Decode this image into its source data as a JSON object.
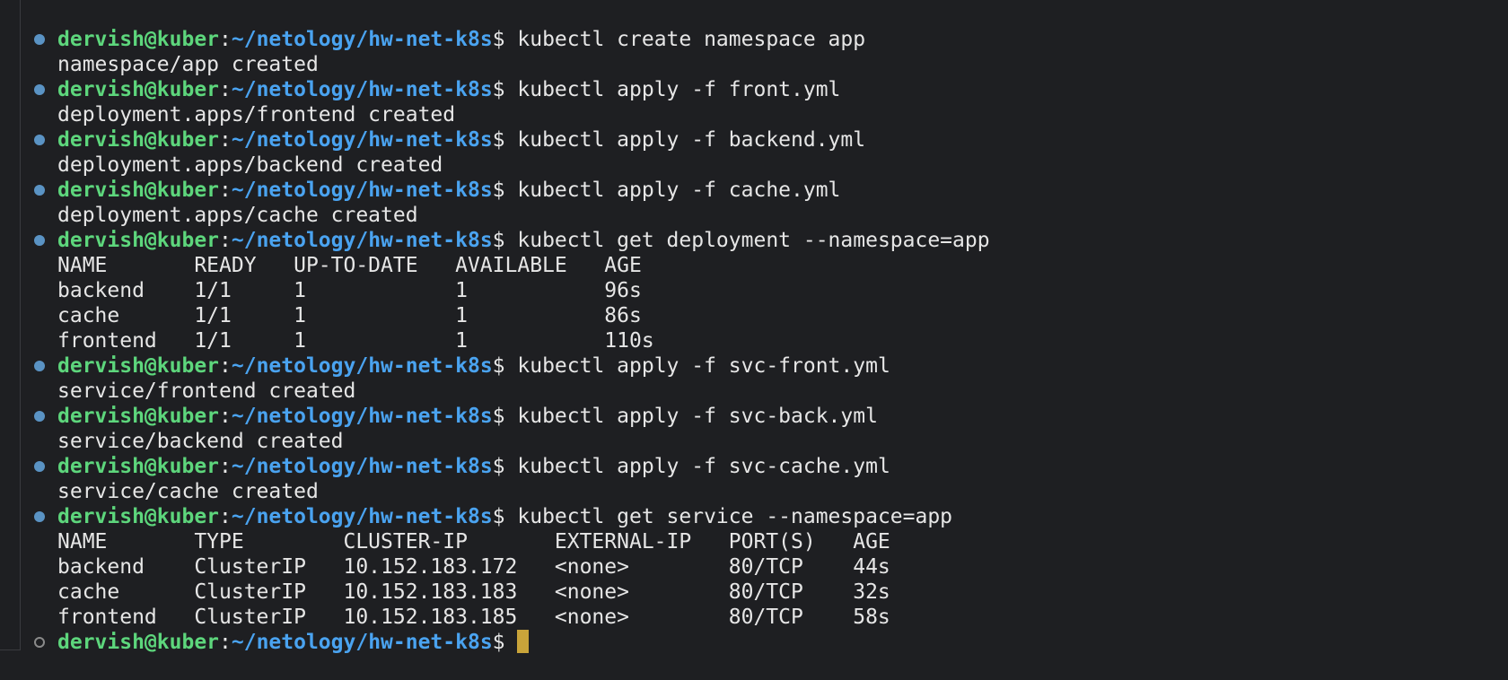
{
  "prompt": {
    "user_host": "dervish@kuber",
    "colon": ":",
    "path": "~/netology/hw-net-k8s",
    "sign": "$ "
  },
  "lines": [
    {
      "kind": "prompt",
      "status": "done",
      "cmd": "kubectl create namespace app"
    },
    {
      "kind": "output",
      "text": "namespace/app created"
    },
    {
      "kind": "prompt",
      "status": "done",
      "cmd": "kubectl apply -f front.yml"
    },
    {
      "kind": "output",
      "text": "deployment.apps/frontend created"
    },
    {
      "kind": "prompt",
      "status": "done",
      "cmd": "kubectl apply -f backend.yml"
    },
    {
      "kind": "output",
      "text": "deployment.apps/backend created"
    },
    {
      "kind": "prompt",
      "status": "done",
      "cmd": "kubectl apply -f cache.yml"
    },
    {
      "kind": "output",
      "text": "deployment.apps/cache created"
    },
    {
      "kind": "prompt",
      "status": "done",
      "cmd": "kubectl get deployment --namespace=app"
    },
    {
      "kind": "output",
      "text": "NAME       READY   UP-TO-DATE   AVAILABLE   AGE"
    },
    {
      "kind": "output",
      "text": "backend    1/1     1            1           96s"
    },
    {
      "kind": "output",
      "text": "cache      1/1     1            1           86s"
    },
    {
      "kind": "output",
      "text": "frontend   1/1     1            1           110s"
    },
    {
      "kind": "prompt",
      "status": "done",
      "cmd": "kubectl apply -f svc-front.yml"
    },
    {
      "kind": "output",
      "text": "service/frontend created"
    },
    {
      "kind": "prompt",
      "status": "done",
      "cmd": "kubectl apply -f svc-back.yml"
    },
    {
      "kind": "output",
      "text": "service/backend created"
    },
    {
      "kind": "prompt",
      "status": "done",
      "cmd": "kubectl apply -f svc-cache.yml"
    },
    {
      "kind": "output",
      "text": "service/cache created"
    },
    {
      "kind": "prompt",
      "status": "done",
      "cmd": "kubectl get service --namespace=app"
    },
    {
      "kind": "output",
      "text": "NAME       TYPE        CLUSTER-IP       EXTERNAL-IP   PORT(S)   AGE"
    },
    {
      "kind": "output",
      "text": "backend    ClusterIP   10.152.183.172   <none>        80/TCP    44s"
    },
    {
      "kind": "output",
      "text": "cache      ClusterIP   10.152.183.183   <none>        80/TCP    32s"
    },
    {
      "kind": "output",
      "text": "frontend   ClusterIP   10.152.183.185   <none>        80/TCP    58s"
    },
    {
      "kind": "prompt",
      "status": "idle",
      "cmd": ""
    }
  ],
  "colors": {
    "background": "#1e1f22",
    "user_host": "#5dd67c",
    "path": "#4aa3f0",
    "text": "#e6e6e6",
    "status_done": "#5a93c4",
    "cursor": "#c9a43a"
  }
}
